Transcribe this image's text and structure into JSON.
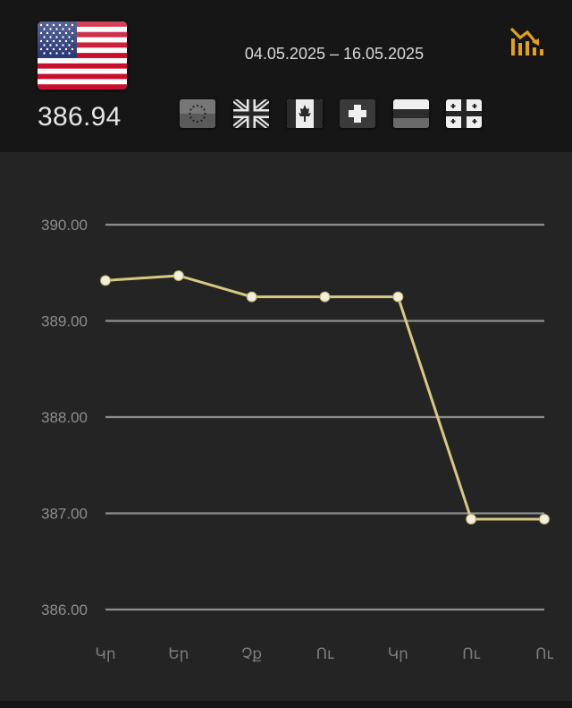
{
  "header": {
    "rate": "386.94",
    "date_range": "04.05.2025 – 16.05.2025",
    "main_flag_icon": "usa-flag-icon",
    "chart_toggle_icon": "chart-down-icon",
    "accent": "#e0a21a",
    "currency_flags": [
      {
        "name": "eu-flag-icon"
      },
      {
        "name": "uk-flag-icon"
      },
      {
        "name": "canada-flag-icon"
      },
      {
        "name": "switzerland-flag-icon"
      },
      {
        "name": "russia-flag-icon"
      },
      {
        "name": "georgia-flag-icon"
      }
    ]
  },
  "chart_data": {
    "type": "line",
    "categories": [
      "Կր",
      "Եր",
      "Չք",
      "Ու",
      "Կր",
      "Ու",
      "Ու"
    ],
    "series": [
      {
        "values": [
          389.42,
          389.47,
          389.25,
          389.25,
          389.25,
          386.94,
          386.94
        ]
      }
    ],
    "yticks": [
      "390.00",
      "389.00",
      "388.00",
      "387.00",
      "386.00"
    ],
    "ylim": [
      386,
      390
    ],
    "grid": true,
    "line_color": "#d8c982",
    "marker_color": "#f2f0dc"
  }
}
